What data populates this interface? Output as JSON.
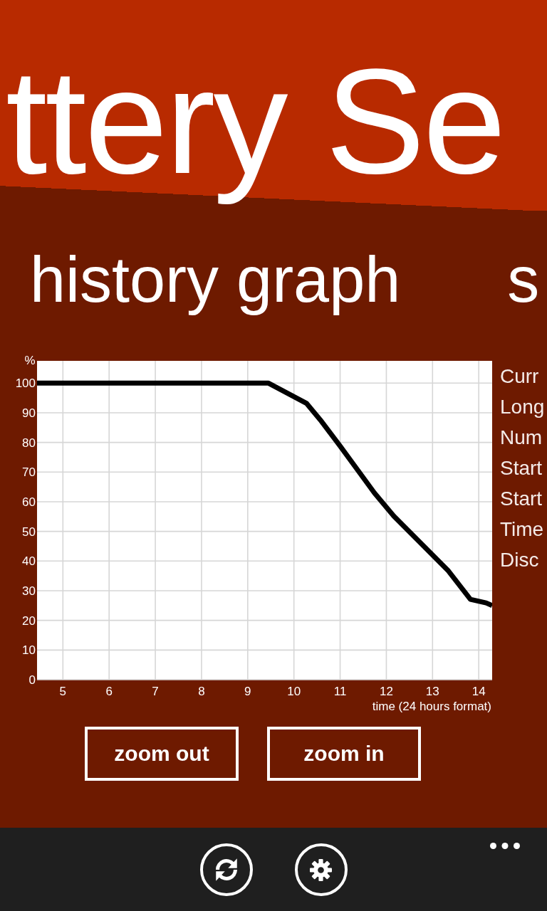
{
  "app_title": "ttery Se",
  "pivot_headers": [
    "history graph",
    "s"
  ],
  "history": {
    "chart_data": {
      "type": "line",
      "ylabel": "%",
      "xlabel": "time (24 hours format)",
      "x": [
        4.44,
        9.45,
        10.27,
        10.57,
        10.99,
        11.74,
        12.16,
        13.33,
        13.82,
        14.16,
        14.29
      ],
      "series": [
        {
          "color": "#000000",
          "values": [
            100,
            100,
            93.2,
            87.6,
            79,
            63,
            55.2,
            36.9,
            27.1,
            25.9,
            25
          ]
        }
      ],
      "xlim": [
        4.44,
        14.29
      ],
      "ylim": [
        0,
        107.5
      ],
      "xticks": [
        5,
        6,
        7,
        8,
        9,
        10,
        11,
        12,
        13,
        14
      ],
      "yticks": [
        0,
        10,
        20,
        30,
        40,
        50,
        60,
        70,
        80,
        90,
        100
      ],
      "grid": true
    },
    "stat_labels": [
      "Curr",
      "Long",
      "Num",
      "Start",
      "Start",
      "Time",
      "Disc"
    ],
    "buttons": [
      "zoom out",
      "zoom in"
    ]
  }
}
